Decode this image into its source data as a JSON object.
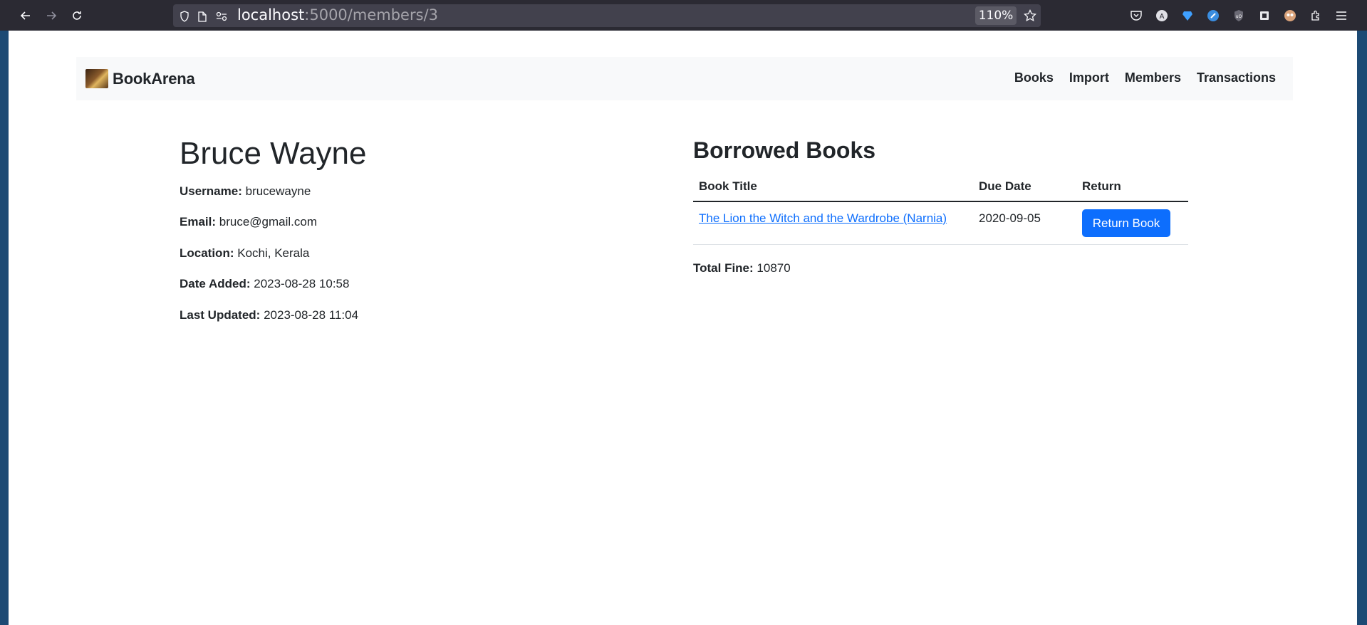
{
  "browser": {
    "url_host": "localhost",
    "url_path": ":5000/members/3",
    "zoom": "110%"
  },
  "navbar": {
    "brand": "BookArena",
    "links": [
      "Books",
      "Import",
      "Members",
      "Transactions"
    ]
  },
  "member": {
    "name": "Bruce Wayne",
    "details": [
      {
        "label": "Username:",
        "value": "brucewayne"
      },
      {
        "label": "Email:",
        "value": "bruce@gmail.com"
      },
      {
        "label": "Location:",
        "value": "Kochi, Kerala"
      },
      {
        "label": "Date Added:",
        "value": "2023-08-28 10:58"
      },
      {
        "label": "Last Updated:",
        "value": "2023-08-28 11:04"
      }
    ]
  },
  "borrowed": {
    "title": "Borrowed Books",
    "columns": [
      "Book Title",
      "Due Date",
      "Return"
    ],
    "rows": [
      {
        "title": "The Lion the Witch and the Wardrobe (Narnia)",
        "due": "2020-09-05",
        "action": "Return Book"
      }
    ],
    "fine_label": "Total Fine:",
    "fine_value": "10870"
  },
  "colors": {
    "primary": "#0d6efd",
    "navbar_bg": "#f8f9fa",
    "chrome_bg": "#2b2a33"
  }
}
